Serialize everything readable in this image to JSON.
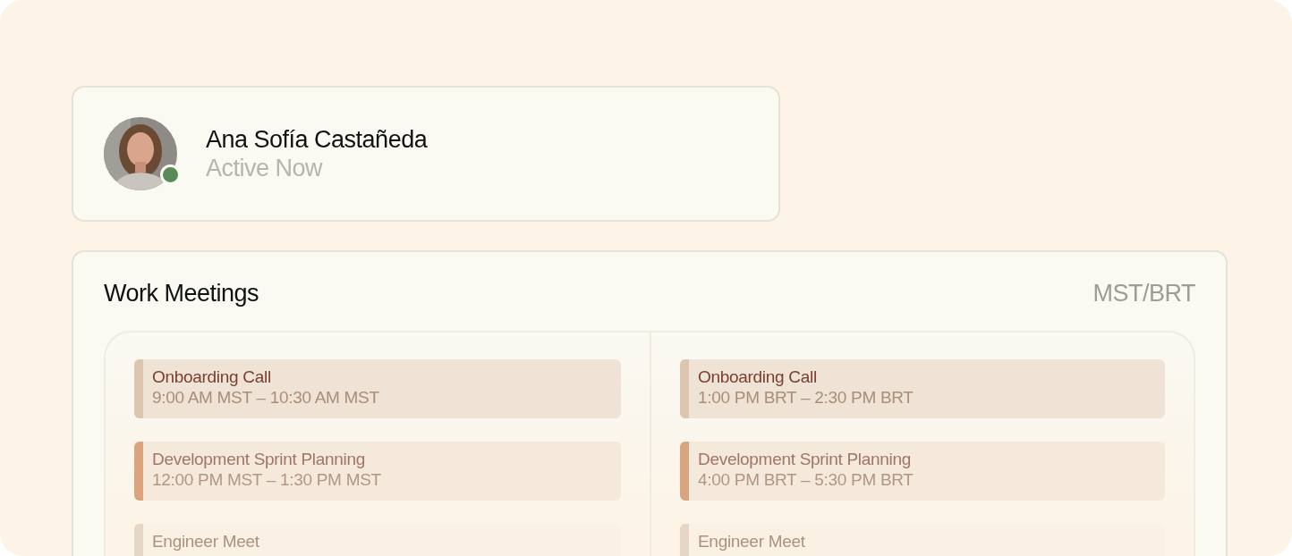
{
  "profile": {
    "name": "Ana Sofía Castañeda",
    "status": "Active Now",
    "online": true
  },
  "meetings": {
    "title": "Work Meetings",
    "timezones": "MST/BRT",
    "columns": [
      {
        "events": [
          {
            "title": "Onboarding Call",
            "time": "9:00 AM MST – 10:30 AM MST",
            "color": "#dcc6b0"
          },
          {
            "title": "Development Sprint Planning",
            "time": "12:00 PM MST – 1:30 PM MST",
            "color": "#d9a47e"
          },
          {
            "title": "Engineer Meet",
            "color": "#e6d6c6"
          }
        ]
      },
      {
        "events": [
          {
            "title": "Onboarding Call",
            "time": "1:00 PM BRT – 2:30 PM BRT",
            "color": "#dcc6b0"
          },
          {
            "title": "Development Sprint Planning",
            "time": "4:00 PM BRT – 5:30 PM BRT",
            "color": "#d9a47e"
          },
          {
            "title": "Engineer Meet",
            "color": "#e6d6c6"
          }
        ]
      }
    ]
  }
}
